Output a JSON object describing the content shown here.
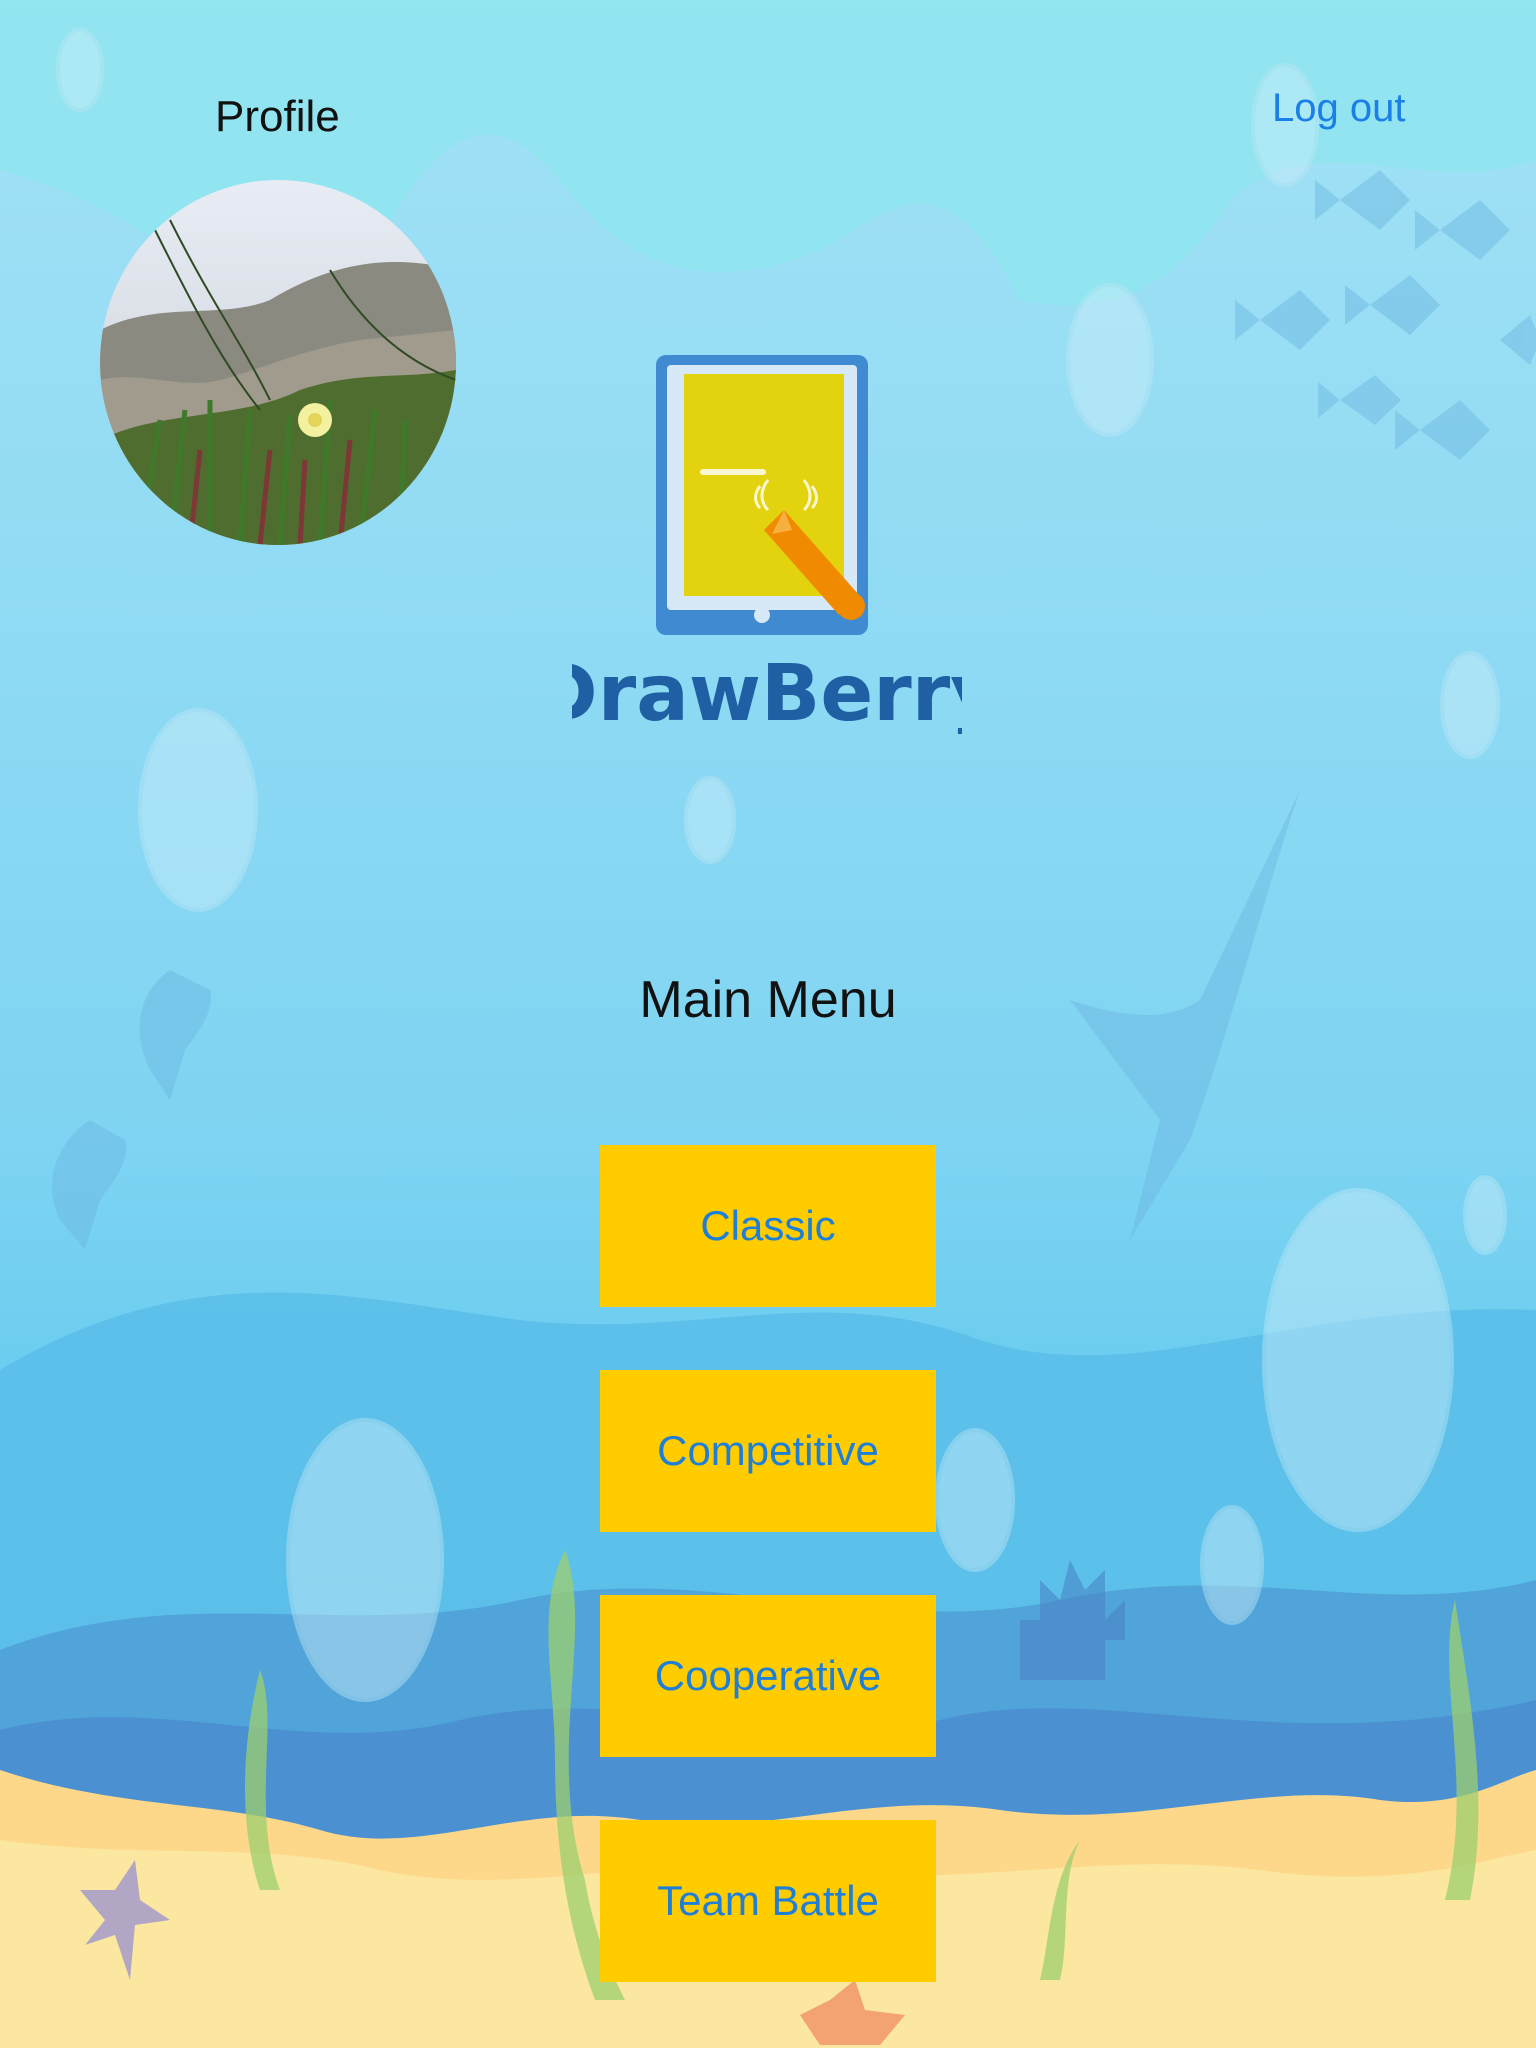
{
  "header": {
    "profile_label": "Profile",
    "logout_label": "Log out"
  },
  "logo": {
    "wordmark": "DrawBerry"
  },
  "main": {
    "title": "Main Menu",
    "buttons": [
      {
        "label": "Classic"
      },
      {
        "label": "Competitive"
      },
      {
        "label": "Cooperative"
      },
      {
        "label": "Team Battle"
      }
    ]
  },
  "colors": {
    "button_bg": "#ffcc00",
    "button_text": "#1f7fd6",
    "link": "#1a7fe6",
    "water_top": "#9ee0f5",
    "sand": "#fbe7a0"
  }
}
